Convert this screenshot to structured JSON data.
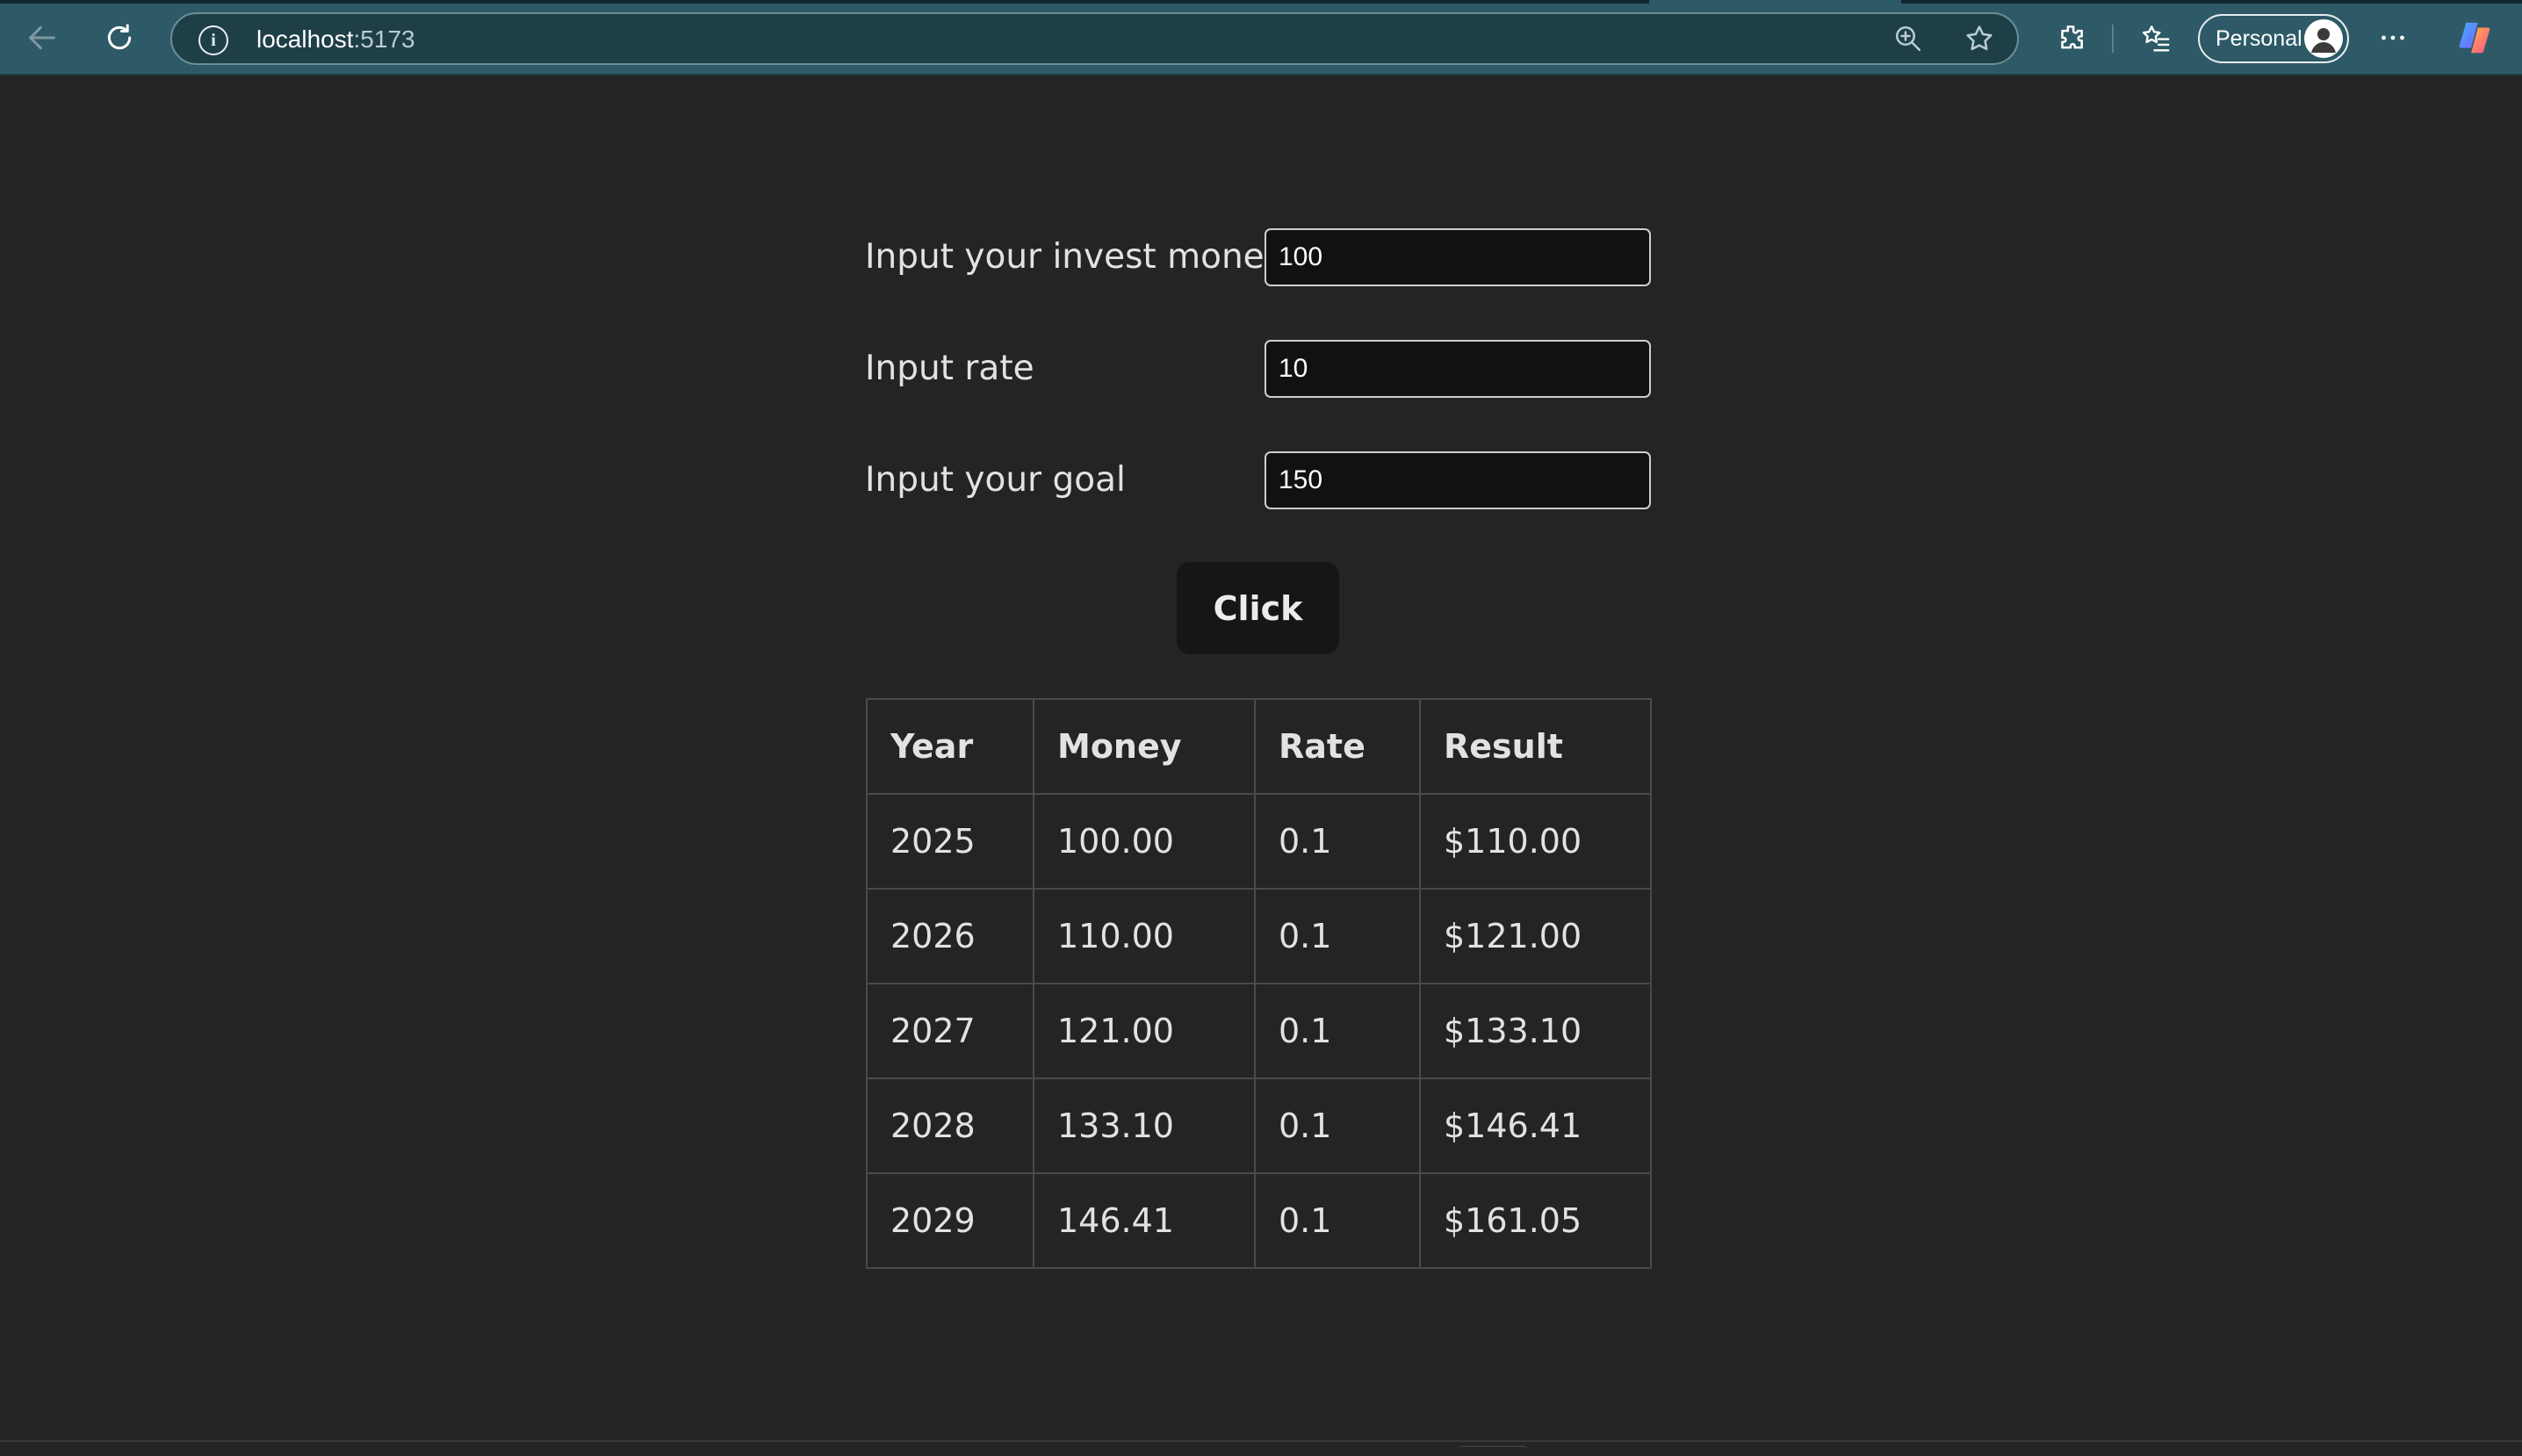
{
  "browser": {
    "url_host": "localhost",
    "url_port": ":5173",
    "profile_label": "Personal",
    "icons": [
      "back-arrow-icon",
      "reload-icon",
      "info-icon",
      "zoom-icon",
      "favorite-star-icon",
      "extensions-icon",
      "favorites-icon",
      "avatar",
      "more-icon",
      "copilot-icon"
    ]
  },
  "form": {
    "invest_label": "Input your invest money",
    "invest_value": "100",
    "rate_label": "Input rate",
    "rate_value": "10",
    "goal_label": "Input your goal",
    "goal_value": "150",
    "button_label": "Click"
  },
  "table": {
    "headers": [
      "Year",
      "Money",
      "Rate",
      "Result"
    ],
    "rows": [
      [
        "2025",
        "100.00",
        "0.1",
        "$110.00"
      ],
      [
        "2026",
        "110.00",
        "0.1",
        "$121.00"
      ],
      [
        "2027",
        "121.00",
        "0.1",
        "$133.10"
      ],
      [
        "2028",
        "133.10",
        "0.1",
        "$146.41"
      ],
      [
        "2029",
        "146.41",
        "0.1",
        "$161.05"
      ]
    ]
  },
  "colors": {
    "page_background": "#242424",
    "toolbar_background": "#2d5a66",
    "input_background": "#111111",
    "button_background": "#161616"
  }
}
